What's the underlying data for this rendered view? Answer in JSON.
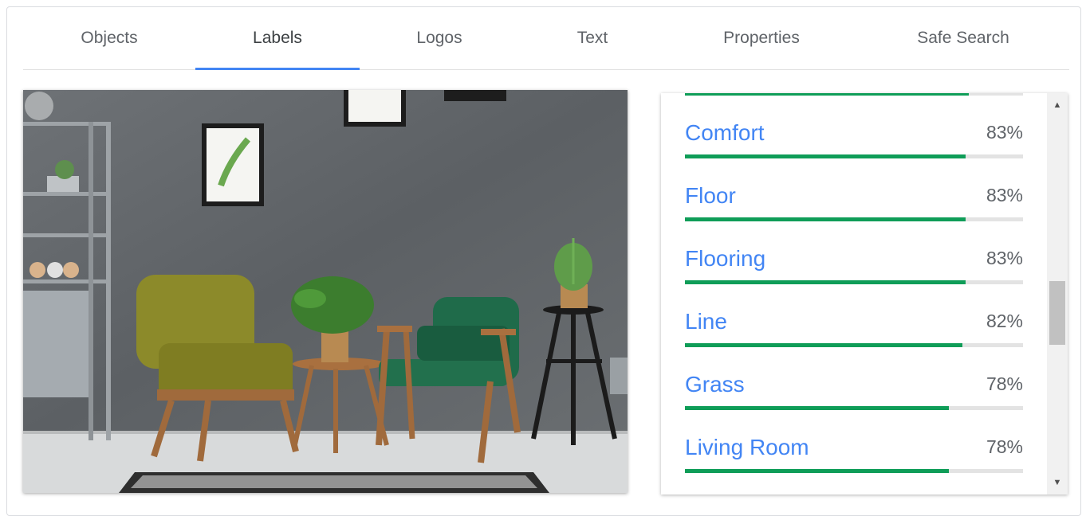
{
  "tabs": [
    {
      "label": "Objects",
      "active": false
    },
    {
      "label": "Labels",
      "active": true
    },
    {
      "label": "Logos",
      "active": false
    },
    {
      "label": "Text",
      "active": false
    },
    {
      "label": "Properties",
      "active": false
    },
    {
      "label": "Safe Search",
      "active": false
    }
  ],
  "labels": [
    {
      "name": "Comfort",
      "percent": "83%",
      "score": 0.83
    },
    {
      "name": "Floor",
      "percent": "83%",
      "score": 0.83
    },
    {
      "name": "Flooring",
      "percent": "83%",
      "score": 0.83
    },
    {
      "name": "Line",
      "percent": "82%",
      "score": 0.82
    },
    {
      "name": "Grass",
      "percent": "78%",
      "score": 0.78
    },
    {
      "name": "Living Room",
      "percent": "78%",
      "score": 0.78
    }
  ],
  "scrollbar": {
    "up_icon": "triangle-up-icon",
    "down_icon": "triangle-down-icon"
  },
  "colors": {
    "accent": "#4285f4",
    "bar": "#0f9d58",
    "track": "#e3e3e3"
  }
}
